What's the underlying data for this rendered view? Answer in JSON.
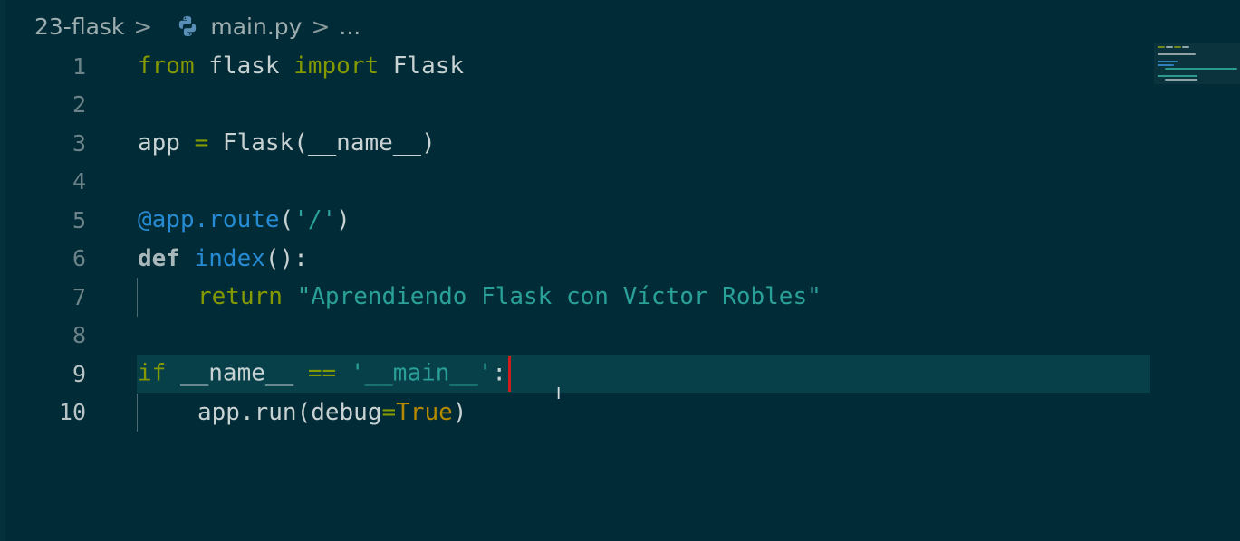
{
  "breadcrumb": {
    "folder": "23-flask",
    "file": "main.py",
    "ellipsis": "...",
    "separator": ">"
  },
  "file_icon": "python-icon",
  "line_numbers": [
    "1",
    "2",
    "3",
    "4",
    "5",
    "6",
    "7",
    "8",
    "9",
    "10"
  ],
  "code": {
    "l1": {
      "kw_from": "from",
      "mod": " flask ",
      "kw_import": "import",
      "name": " Flask"
    },
    "l3": {
      "var": "app ",
      "eq": "=",
      "call": " Flask(__name__)"
    },
    "l5": {
      "decor": "@app.route",
      "open": "(",
      "str": "'/'",
      "close": ")"
    },
    "l6": {
      "kw": "def",
      "sp": " ",
      "fn": "index",
      "rest": "():"
    },
    "l7": {
      "kw": "return",
      "sp": " ",
      "str": "\"Aprendiendo Flask con Víctor Robles\""
    },
    "l9": {
      "kw": "if",
      "a": " __name__ ",
      "op": "==",
      "sp": " ",
      "str": "'__main__'",
      "colon": ":"
    },
    "l10": {
      "a": "app.run(debug",
      "eq": "=",
      "val": "True",
      "close": ")"
    }
  },
  "cursor_line": "9",
  "colors": {
    "background": "#012b36",
    "keyword": "#859900",
    "function": "#268bd2",
    "string": "#2aa198",
    "constant": "#b58900",
    "cursor": "#cf1d1d"
  }
}
